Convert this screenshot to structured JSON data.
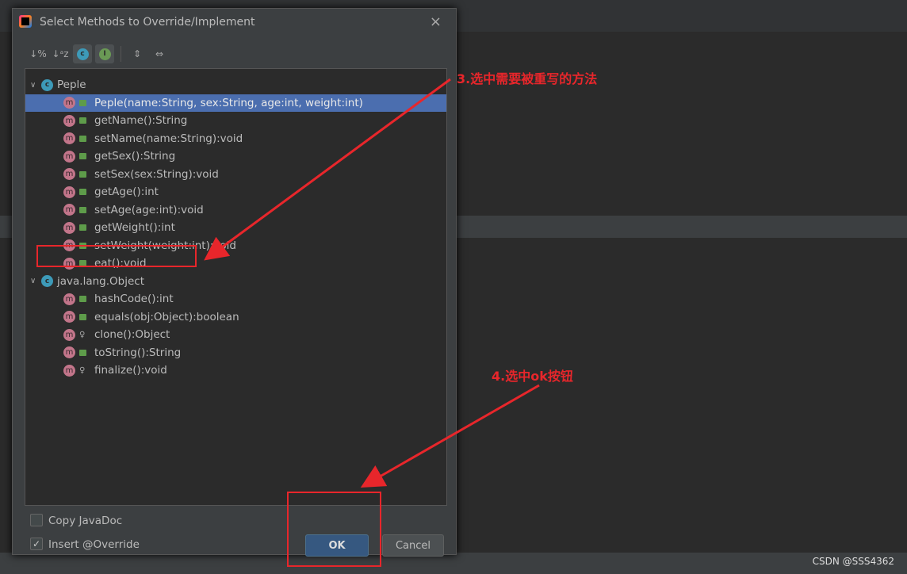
{
  "dialog": {
    "title": "Select Methods to Override/Implement",
    "close": "×"
  },
  "toolbar": [
    {
      "icon": "sort-by-visibility-icon",
      "glyph": "↓%"
    },
    {
      "icon": "sort-alpha-icon",
      "glyph": "↓ᵃz"
    },
    {
      "icon": "show-classes-icon",
      "glyph": "c"
    },
    {
      "icon": "show-interfaces-icon",
      "glyph": "I"
    },
    {
      "icon": "expand-all-icon",
      "glyph": "⇕"
    },
    {
      "icon": "collapse-all-icon",
      "glyph": "⇔"
    }
  ],
  "groups": [
    {
      "name": "Peple",
      "methods": [
        {
          "label": "Peple(name:String, sex:String, age:int, weight:int)",
          "access": "public",
          "selected": true
        },
        {
          "label": "getName():String",
          "access": "public"
        },
        {
          "label": "setName(name:String):void",
          "access": "public"
        },
        {
          "label": "getSex():String",
          "access": "public"
        },
        {
          "label": "setSex(sex:String):void",
          "access": "public"
        },
        {
          "label": "getAge():int",
          "access": "public"
        },
        {
          "label": "setAge(age:int):void",
          "access": "public"
        },
        {
          "label": "getWeight():int",
          "access": "public"
        },
        {
          "label": "setWeight(weight:int):void",
          "access": "public"
        },
        {
          "label": "eat():void",
          "access": "public"
        }
      ]
    },
    {
      "name": "java.lang.Object",
      "methods": [
        {
          "label": "hashCode():int",
          "access": "public"
        },
        {
          "label": "equals(obj:Object):boolean",
          "access": "public"
        },
        {
          "label": "clone():Object",
          "access": "protected"
        },
        {
          "label": "toString():String",
          "access": "public"
        },
        {
          "label": "finalize():void",
          "access": "protected"
        }
      ]
    }
  ],
  "options": {
    "copy_javadoc": {
      "label": "Copy JavaDoc",
      "checked": false
    },
    "insert_override": {
      "label": "Insert @Override",
      "checked": true
    }
  },
  "buttons": {
    "ok": "OK",
    "cancel": "Cancel"
  },
  "annotations": {
    "step3": "3.选中需要被重写的方法",
    "step4": "4.选中ok按钮",
    "color": "#e8262b"
  },
  "watermark": "CSDN @SSS4362",
  "colors": {
    "selection": "#4b6eaf",
    "dialog": "#3c3f41",
    "method_icon": "#c2758a",
    "class_icon": "#3d9ab8"
  }
}
